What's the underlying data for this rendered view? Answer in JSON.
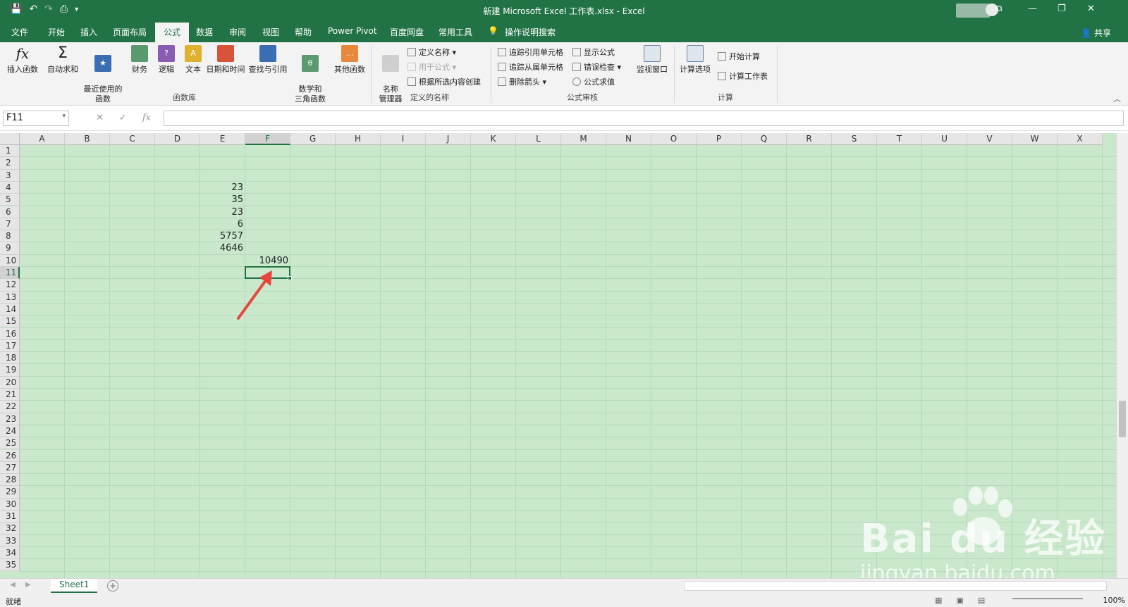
{
  "app": {
    "title": "新建 Microsoft Excel 工作表.xlsx - Excel",
    "share_label": "共享"
  },
  "menu": {
    "tabs": [
      "文件",
      "开始",
      "插入",
      "页面布局",
      "公式",
      "数据",
      "审阅",
      "视图",
      "帮助",
      "Power Pivot",
      "百度网盘",
      "常用工具"
    ],
    "active": "公式",
    "search_label": "操作说明搜索"
  },
  "ribbon": {
    "function_library": {
      "group_label": "函数库",
      "buttons": [
        "插入函数",
        "自动求和",
        "最近使用的\n函数",
        "财务",
        "逻辑",
        "文本",
        "日期和时间",
        "查找与引用",
        "数学和\n三角函数",
        "其他函数"
      ]
    },
    "defined_names": {
      "group_label": "定义的名称",
      "name_manager": "名称\n管理器",
      "define_name": "定义名称",
      "use_in_formula": "用于公式",
      "create_from_selection": "根据所选内容创建"
    },
    "formula_auditing": {
      "group_label": "公式审核",
      "trace_precedents": "追踪引用单元格",
      "trace_dependents": "追踪从属单元格",
      "remove_arrows": "删除箭头",
      "show_formulas": "显示公式",
      "error_checking": "错误检查",
      "evaluate_formula": "公式求值",
      "watch_window": "监视窗口"
    },
    "calculation": {
      "group_label": "计算",
      "options": "计算选项",
      "calc_now": "开始计算",
      "calc_sheet": "计算工作表"
    }
  },
  "formula_bar": {
    "name_box": "F11",
    "formula": ""
  },
  "grid": {
    "columns": [
      "A",
      "B",
      "C",
      "D",
      "E",
      "F",
      "G",
      "H",
      "I",
      "J",
      "K",
      "L",
      "M",
      "N",
      "O",
      "P",
      "Q",
      "R",
      "S",
      "T",
      "U",
      "V",
      "W",
      "X"
    ],
    "rows": [
      "1",
      "2",
      "3",
      "4",
      "5",
      "6",
      "7",
      "8",
      "9",
      "10",
      "11",
      "12",
      "13",
      "14",
      "15",
      "16",
      "17",
      "18",
      "19",
      "20",
      "21",
      "22",
      "23",
      "24",
      "25",
      "26",
      "27",
      "28",
      "29",
      "30",
      "31",
      "32",
      "33",
      "34",
      "35"
    ],
    "selected_cell": "F11",
    "cells": {
      "E4": "23",
      "E5": "35",
      "E6": "23",
      "E7": "6",
      "E8": "5757",
      "E9": "4646",
      "F10": "10490"
    }
  },
  "sheets": {
    "tabs": [
      "Sheet1"
    ],
    "active": "Sheet1"
  },
  "status": {
    "ready": "就绪",
    "zoom": "100%"
  },
  "watermark": {
    "logo": "Bai du 经验",
    "url": "jingyan.baidu.com"
  },
  "colors": {
    "accent": "#217346",
    "grid_bg": "#c9e8cc",
    "arrow": "#e8473c"
  }
}
